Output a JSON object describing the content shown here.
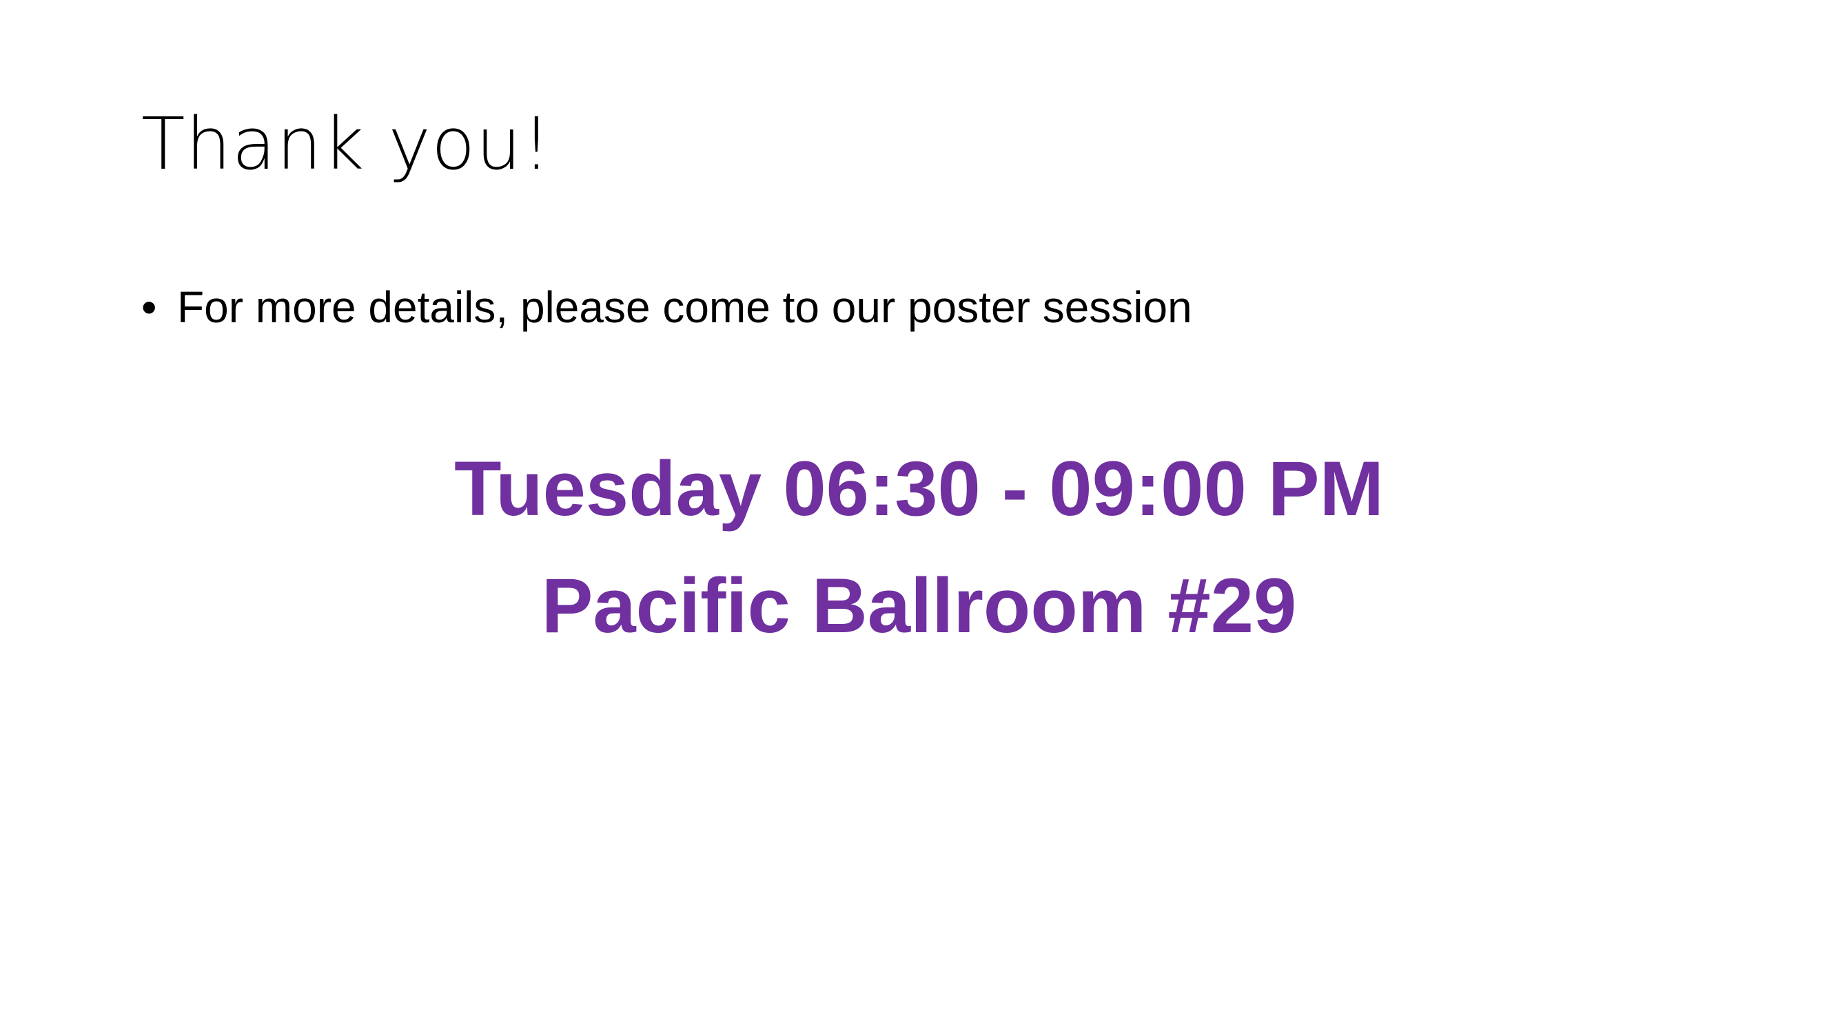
{
  "slide": {
    "title": "Thank you!",
    "bullet_symbol": "•",
    "bullet_text": "For more details, please come to our poster session",
    "session_time": "Tuesday 06:30 - 09:00 PM",
    "session_location": "Pacific Ballroom #29",
    "colors": {
      "highlight": "#7030a0",
      "text": "#000000",
      "background": "#ffffff"
    }
  }
}
